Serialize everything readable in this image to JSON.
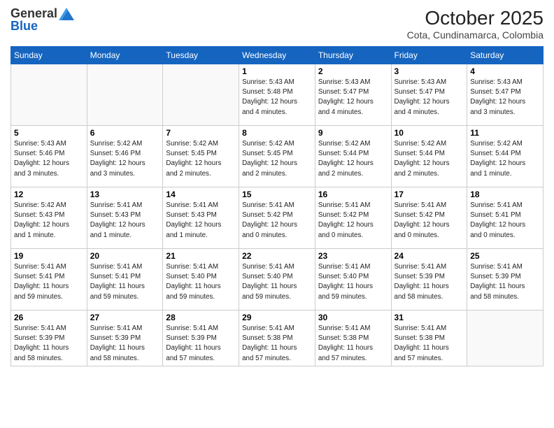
{
  "header": {
    "logo_general": "General",
    "logo_blue": "Blue",
    "month_year": "October 2025",
    "location": "Cota, Cundinamarca, Colombia"
  },
  "days_of_week": [
    "Sunday",
    "Monday",
    "Tuesday",
    "Wednesday",
    "Thursday",
    "Friday",
    "Saturday"
  ],
  "weeks": [
    [
      {
        "day": "",
        "info": ""
      },
      {
        "day": "",
        "info": ""
      },
      {
        "day": "",
        "info": ""
      },
      {
        "day": "1",
        "info": "Sunrise: 5:43 AM\nSunset: 5:48 PM\nDaylight: 12 hours\nand 4 minutes."
      },
      {
        "day": "2",
        "info": "Sunrise: 5:43 AM\nSunset: 5:47 PM\nDaylight: 12 hours\nand 4 minutes."
      },
      {
        "day": "3",
        "info": "Sunrise: 5:43 AM\nSunset: 5:47 PM\nDaylight: 12 hours\nand 4 minutes."
      },
      {
        "day": "4",
        "info": "Sunrise: 5:43 AM\nSunset: 5:47 PM\nDaylight: 12 hours\nand 3 minutes."
      }
    ],
    [
      {
        "day": "5",
        "info": "Sunrise: 5:43 AM\nSunset: 5:46 PM\nDaylight: 12 hours\nand 3 minutes."
      },
      {
        "day": "6",
        "info": "Sunrise: 5:42 AM\nSunset: 5:46 PM\nDaylight: 12 hours\nand 3 minutes."
      },
      {
        "day": "7",
        "info": "Sunrise: 5:42 AM\nSunset: 5:45 PM\nDaylight: 12 hours\nand 2 minutes."
      },
      {
        "day": "8",
        "info": "Sunrise: 5:42 AM\nSunset: 5:45 PM\nDaylight: 12 hours\nand 2 minutes."
      },
      {
        "day": "9",
        "info": "Sunrise: 5:42 AM\nSunset: 5:44 PM\nDaylight: 12 hours\nand 2 minutes."
      },
      {
        "day": "10",
        "info": "Sunrise: 5:42 AM\nSunset: 5:44 PM\nDaylight: 12 hours\nand 2 minutes."
      },
      {
        "day": "11",
        "info": "Sunrise: 5:42 AM\nSunset: 5:44 PM\nDaylight: 12 hours\nand 1 minute."
      }
    ],
    [
      {
        "day": "12",
        "info": "Sunrise: 5:42 AM\nSunset: 5:43 PM\nDaylight: 12 hours\nand 1 minute."
      },
      {
        "day": "13",
        "info": "Sunrise: 5:41 AM\nSunset: 5:43 PM\nDaylight: 12 hours\nand 1 minute."
      },
      {
        "day": "14",
        "info": "Sunrise: 5:41 AM\nSunset: 5:43 PM\nDaylight: 12 hours\nand 1 minute."
      },
      {
        "day": "15",
        "info": "Sunrise: 5:41 AM\nSunset: 5:42 PM\nDaylight: 12 hours\nand 0 minutes."
      },
      {
        "day": "16",
        "info": "Sunrise: 5:41 AM\nSunset: 5:42 PM\nDaylight: 12 hours\nand 0 minutes."
      },
      {
        "day": "17",
        "info": "Sunrise: 5:41 AM\nSunset: 5:42 PM\nDaylight: 12 hours\nand 0 minutes."
      },
      {
        "day": "18",
        "info": "Sunrise: 5:41 AM\nSunset: 5:41 PM\nDaylight: 12 hours\nand 0 minutes."
      }
    ],
    [
      {
        "day": "19",
        "info": "Sunrise: 5:41 AM\nSunset: 5:41 PM\nDaylight: 11 hours\nand 59 minutes."
      },
      {
        "day": "20",
        "info": "Sunrise: 5:41 AM\nSunset: 5:41 PM\nDaylight: 11 hours\nand 59 minutes."
      },
      {
        "day": "21",
        "info": "Sunrise: 5:41 AM\nSunset: 5:40 PM\nDaylight: 11 hours\nand 59 minutes."
      },
      {
        "day": "22",
        "info": "Sunrise: 5:41 AM\nSunset: 5:40 PM\nDaylight: 11 hours\nand 59 minutes."
      },
      {
        "day": "23",
        "info": "Sunrise: 5:41 AM\nSunset: 5:40 PM\nDaylight: 11 hours\nand 59 minutes."
      },
      {
        "day": "24",
        "info": "Sunrise: 5:41 AM\nSunset: 5:39 PM\nDaylight: 11 hours\nand 58 minutes."
      },
      {
        "day": "25",
        "info": "Sunrise: 5:41 AM\nSunset: 5:39 PM\nDaylight: 11 hours\nand 58 minutes."
      }
    ],
    [
      {
        "day": "26",
        "info": "Sunrise: 5:41 AM\nSunset: 5:39 PM\nDaylight: 11 hours\nand 58 minutes."
      },
      {
        "day": "27",
        "info": "Sunrise: 5:41 AM\nSunset: 5:39 PM\nDaylight: 11 hours\nand 58 minutes."
      },
      {
        "day": "28",
        "info": "Sunrise: 5:41 AM\nSunset: 5:39 PM\nDaylight: 11 hours\nand 57 minutes."
      },
      {
        "day": "29",
        "info": "Sunrise: 5:41 AM\nSunset: 5:38 PM\nDaylight: 11 hours\nand 57 minutes."
      },
      {
        "day": "30",
        "info": "Sunrise: 5:41 AM\nSunset: 5:38 PM\nDaylight: 11 hours\nand 57 minutes."
      },
      {
        "day": "31",
        "info": "Sunrise: 5:41 AM\nSunset: 5:38 PM\nDaylight: 11 hours\nand 57 minutes."
      },
      {
        "day": "",
        "info": ""
      }
    ]
  ]
}
